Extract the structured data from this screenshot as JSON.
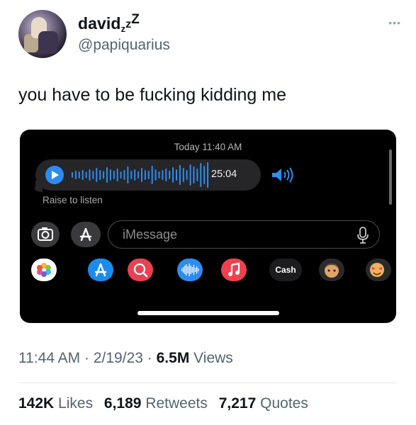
{
  "tweet": {
    "display_name": "david",
    "display_name_suffix": [
      "z",
      "z",
      "Z"
    ],
    "handle": "@papiquarius",
    "text": "you have to be fucking kidding me",
    "more_icon": "ellipsis-icon"
  },
  "media": {
    "timestamp": "Today 11:40 AM",
    "audio": {
      "duration": "25:04",
      "play_icon": "play-icon",
      "speaker_icon": "speaker-icon",
      "accent_color": "#2d8cf0"
    },
    "raise_to_listen": "Raise to listen",
    "input": {
      "placeholder": "iMessage",
      "camera_icon": "camera-icon",
      "apps_icon": "app-store-icon",
      "mic_icon": "microphone-icon"
    },
    "app_drawer": {
      "apps": [
        "photos",
        "app-store",
        "search-images",
        "audio-message",
        "music",
        "apple-cash",
        "memoji",
        "memoji-stickers"
      ],
      "cash_label": "Cash"
    }
  },
  "meta": {
    "time": "11:44 AM",
    "date": "2/19/23",
    "views_count": "6.5M",
    "views_label": "Views",
    "separator": "·"
  },
  "stats": {
    "likes_count": "142K",
    "likes_label": "Likes",
    "retweets_count": "6,189",
    "retweets_label": "Retweets",
    "quotes_count": "7,217",
    "quotes_label": "Quotes"
  }
}
